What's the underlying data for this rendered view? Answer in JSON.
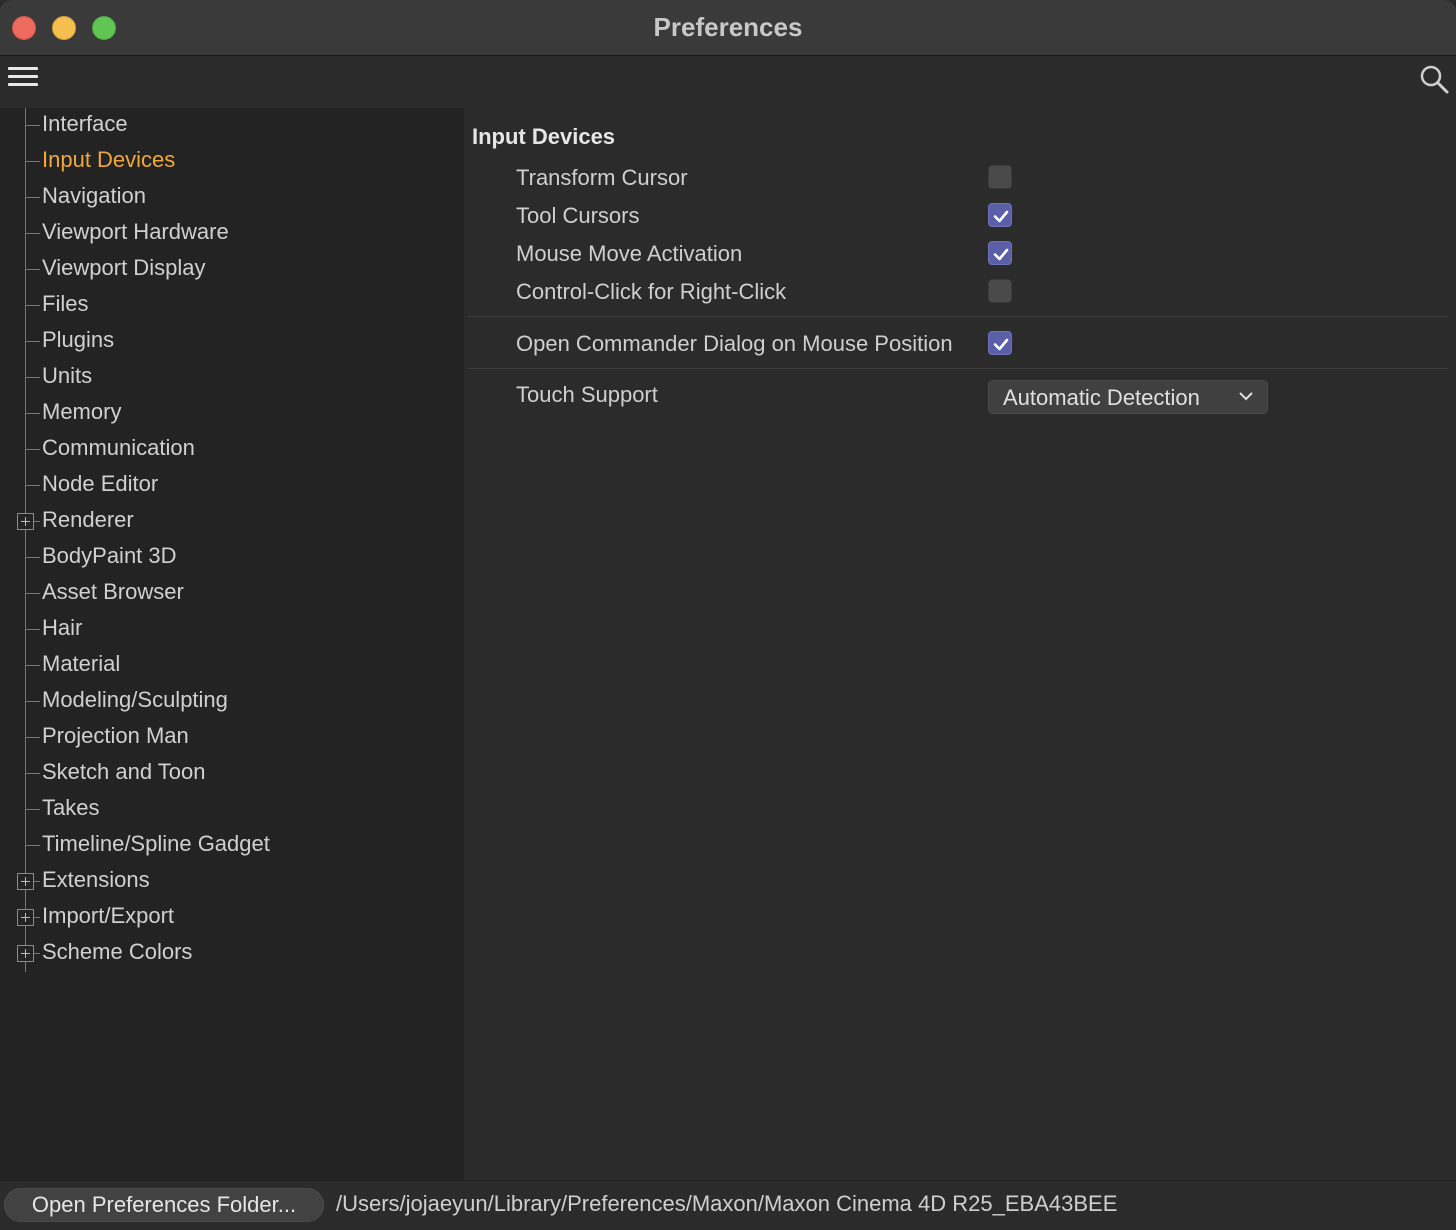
{
  "window": {
    "title": "Preferences"
  },
  "sidebar": {
    "items": [
      {
        "label": "Interface",
        "expandable": false,
        "active": false
      },
      {
        "label": "Input Devices",
        "expandable": false,
        "active": true
      },
      {
        "label": "Navigation",
        "expandable": false,
        "active": false
      },
      {
        "label": "Viewport Hardware",
        "expandable": false,
        "active": false
      },
      {
        "label": "Viewport Display",
        "expandable": false,
        "active": false
      },
      {
        "label": "Files",
        "expandable": false,
        "active": false
      },
      {
        "label": "Plugins",
        "expandable": false,
        "active": false
      },
      {
        "label": "Units",
        "expandable": false,
        "active": false
      },
      {
        "label": "Memory",
        "expandable": false,
        "active": false
      },
      {
        "label": "Communication",
        "expandable": false,
        "active": false
      },
      {
        "label": "Node Editor",
        "expandable": false,
        "active": false
      },
      {
        "label": "Renderer",
        "expandable": true,
        "active": false
      },
      {
        "label": "BodyPaint 3D",
        "expandable": false,
        "active": false
      },
      {
        "label": "Asset Browser",
        "expandable": false,
        "active": false
      },
      {
        "label": "Hair",
        "expandable": false,
        "active": false
      },
      {
        "label": "Material",
        "expandable": false,
        "active": false
      },
      {
        "label": "Modeling/Sculpting",
        "expandable": false,
        "active": false
      },
      {
        "label": "Projection Man",
        "expandable": false,
        "active": false
      },
      {
        "label": "Sketch and Toon",
        "expandable": false,
        "active": false
      },
      {
        "label": "Takes",
        "expandable": false,
        "active": false
      },
      {
        "label": "Timeline/Spline Gadget",
        "expandable": false,
        "active": false
      },
      {
        "label": "Extensions",
        "expandable": true,
        "active": false
      },
      {
        "label": "Import/Export",
        "expandable": true,
        "active": false
      },
      {
        "label": "Scheme Colors",
        "expandable": true,
        "active": false
      }
    ]
  },
  "main": {
    "section_title": "Input Devices",
    "options": [
      {
        "label": "Transform Cursor",
        "checked": false
      },
      {
        "label": "Tool Cursors",
        "checked": true
      },
      {
        "label": "Mouse Move Activation",
        "checked": true
      },
      {
        "label": "Control-Click for Right-Click",
        "checked": false
      }
    ],
    "commander": {
      "label": "Open Commander Dialog on Mouse Position",
      "checked": true
    },
    "touch_support": {
      "label": "Touch Support",
      "value": "Automatic Detection"
    }
  },
  "footer": {
    "button_label": "Open Preferences Folder...",
    "path": "/Users/jojaeyun/Library/Preferences/Maxon/Maxon Cinema 4D R25_EBA43BEE"
  },
  "colors": {
    "active_item": "#f2a73d",
    "checkbox_checked": "#5b5fa8",
    "close": "#ed6a5e",
    "minimize": "#f5bf4f",
    "zoom": "#61c554"
  }
}
